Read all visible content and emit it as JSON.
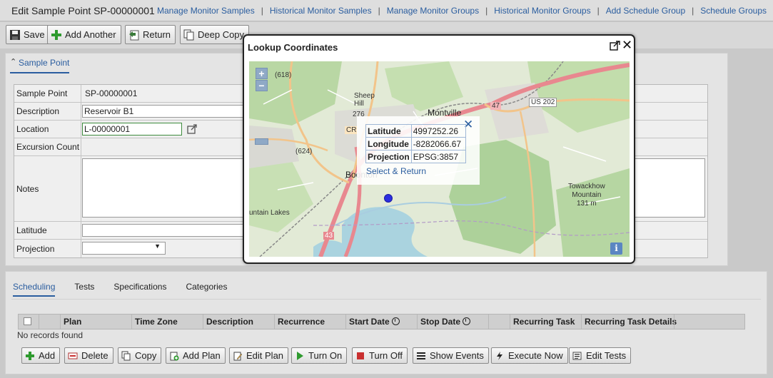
{
  "header": {
    "title": "Edit Sample Point SP-00000001",
    "links": [
      "Manage Monitor Samples",
      "Historical Monitor Samples",
      "Manage Monitor Groups",
      "Historical Monitor Groups",
      "Add Schedule Group",
      "Schedule Groups"
    ],
    "separator": "|"
  },
  "toolbar": {
    "save": "Save",
    "add_another": "Add Another",
    "return": "Return",
    "deep_copy": "Deep Copy"
  },
  "section": {
    "title": "Sample Point"
  },
  "form": {
    "sample_point": {
      "label": "Sample Point",
      "value": "SP-00000001"
    },
    "description": {
      "label": "Description",
      "value": "Reservoir B1"
    },
    "location": {
      "label": "Location",
      "value": "L-00000001"
    },
    "excursion_count": {
      "label": "Excursion Count",
      "value": ""
    },
    "notes": {
      "label": "Notes",
      "value": ""
    },
    "latitude": {
      "label": "Latitude",
      "value": ""
    },
    "projection": {
      "label": "Projection",
      "value": ""
    }
  },
  "dialog": {
    "title": "Lookup Coordinates",
    "zoom_in": "+",
    "zoom_out": "−",
    "info": "i",
    "popup": {
      "rows": [
        {
          "key": "Latitude",
          "value": "4997252.26"
        },
        {
          "key": "Longitude",
          "value": "-8282066.67"
        },
        {
          "key": "Projection",
          "value": "EPSG:3857"
        }
      ],
      "action": "Select & Return",
      "close": "✕"
    },
    "map_labels": {
      "r618": "(618)",
      "sheep_hill": "Sheep\nHill",
      "r276": "276",
      "cr": "CR",
      "r624": "(624)",
      "montville": "Montville",
      "us202": "US 202",
      "r47": "47",
      "boonton": "Boonton",
      "towackhow": "Towackhow\nMountain\n131 m",
      "lakes": "untain Lakes",
      "r43": "43"
    }
  },
  "bottom": {
    "tabs": [
      "Scheduling",
      "Tests",
      "Specifications",
      "Categories"
    ],
    "active_tab": 0,
    "columns": [
      "Plan",
      "Time Zone",
      "Description",
      "Recurrence",
      "Start Date",
      "Stop Date",
      "Recurring Task",
      "Recurring Task Details"
    ],
    "empty_text": "No records found",
    "buttons": {
      "add": "Add",
      "delete": "Delete",
      "copy": "Copy",
      "add_plan": "Add Plan",
      "edit_plan": "Edit Plan",
      "turn_on": "Turn On",
      "turn_off": "Turn Off",
      "show_events": "Show Events",
      "execute_now": "Execute Now",
      "edit_tests": "Edit Tests"
    }
  },
  "colors": {
    "link": "#2a5d9f",
    "highway": "#e8888f",
    "road": "#f2c48a",
    "water": "#aad3df",
    "marker": "#2b2ee0"
  }
}
